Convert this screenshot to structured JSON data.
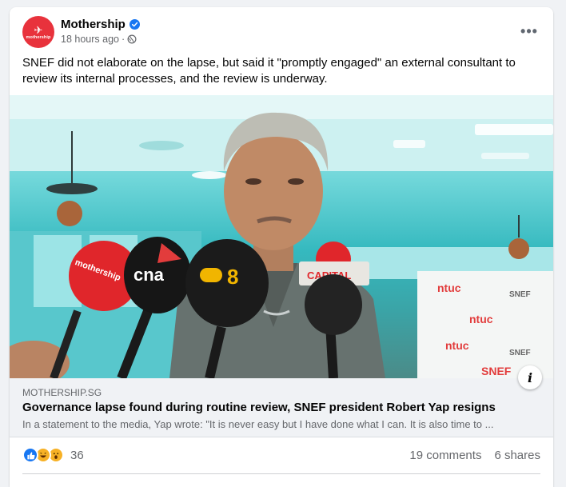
{
  "post": {
    "page_name": "Mothership",
    "avatar_text": "mothership",
    "timestamp": "18 hours ago",
    "separator": "·",
    "more_label": "•••",
    "text": "SNEF did not elaborate on the lapse, but said it \"promptly engaged\" an external consultant to review its internal processes, and the review is underway."
  },
  "image": {
    "mic_labels": {
      "mothership": "mothership",
      "cna": "cna",
      "ch8": "8",
      "capital": "CAPITAL"
    },
    "backdrop_labels": [
      "ntuc",
      "SNEF",
      "ntuc",
      "SNEF",
      "ntuc",
      "SNEF"
    ]
  },
  "link_preview": {
    "domain": "MOTHERSHIP.SG",
    "title": "Governance lapse found during routine review, SNEF president Robert Yap resigns",
    "description": "In a statement to the media, Yap wrote: \"It is never easy but I have done what I can. It is also time to ...",
    "info_label": "i"
  },
  "footer": {
    "reaction_count": "36",
    "comments": "19 comments",
    "shares": "6 shares"
  },
  "icons": [
    "verified-badge-icon",
    "globe-icon",
    "more-options-icon",
    "info-icon",
    "like-reaction-icon",
    "haha-reaction-icon",
    "wow-reaction-icon"
  ],
  "colors": {
    "brand_red": "#e8323c",
    "facebook_blue": "#1877f2",
    "reaction_yellow": "#f7b125",
    "secondary_text": "#65676b"
  }
}
